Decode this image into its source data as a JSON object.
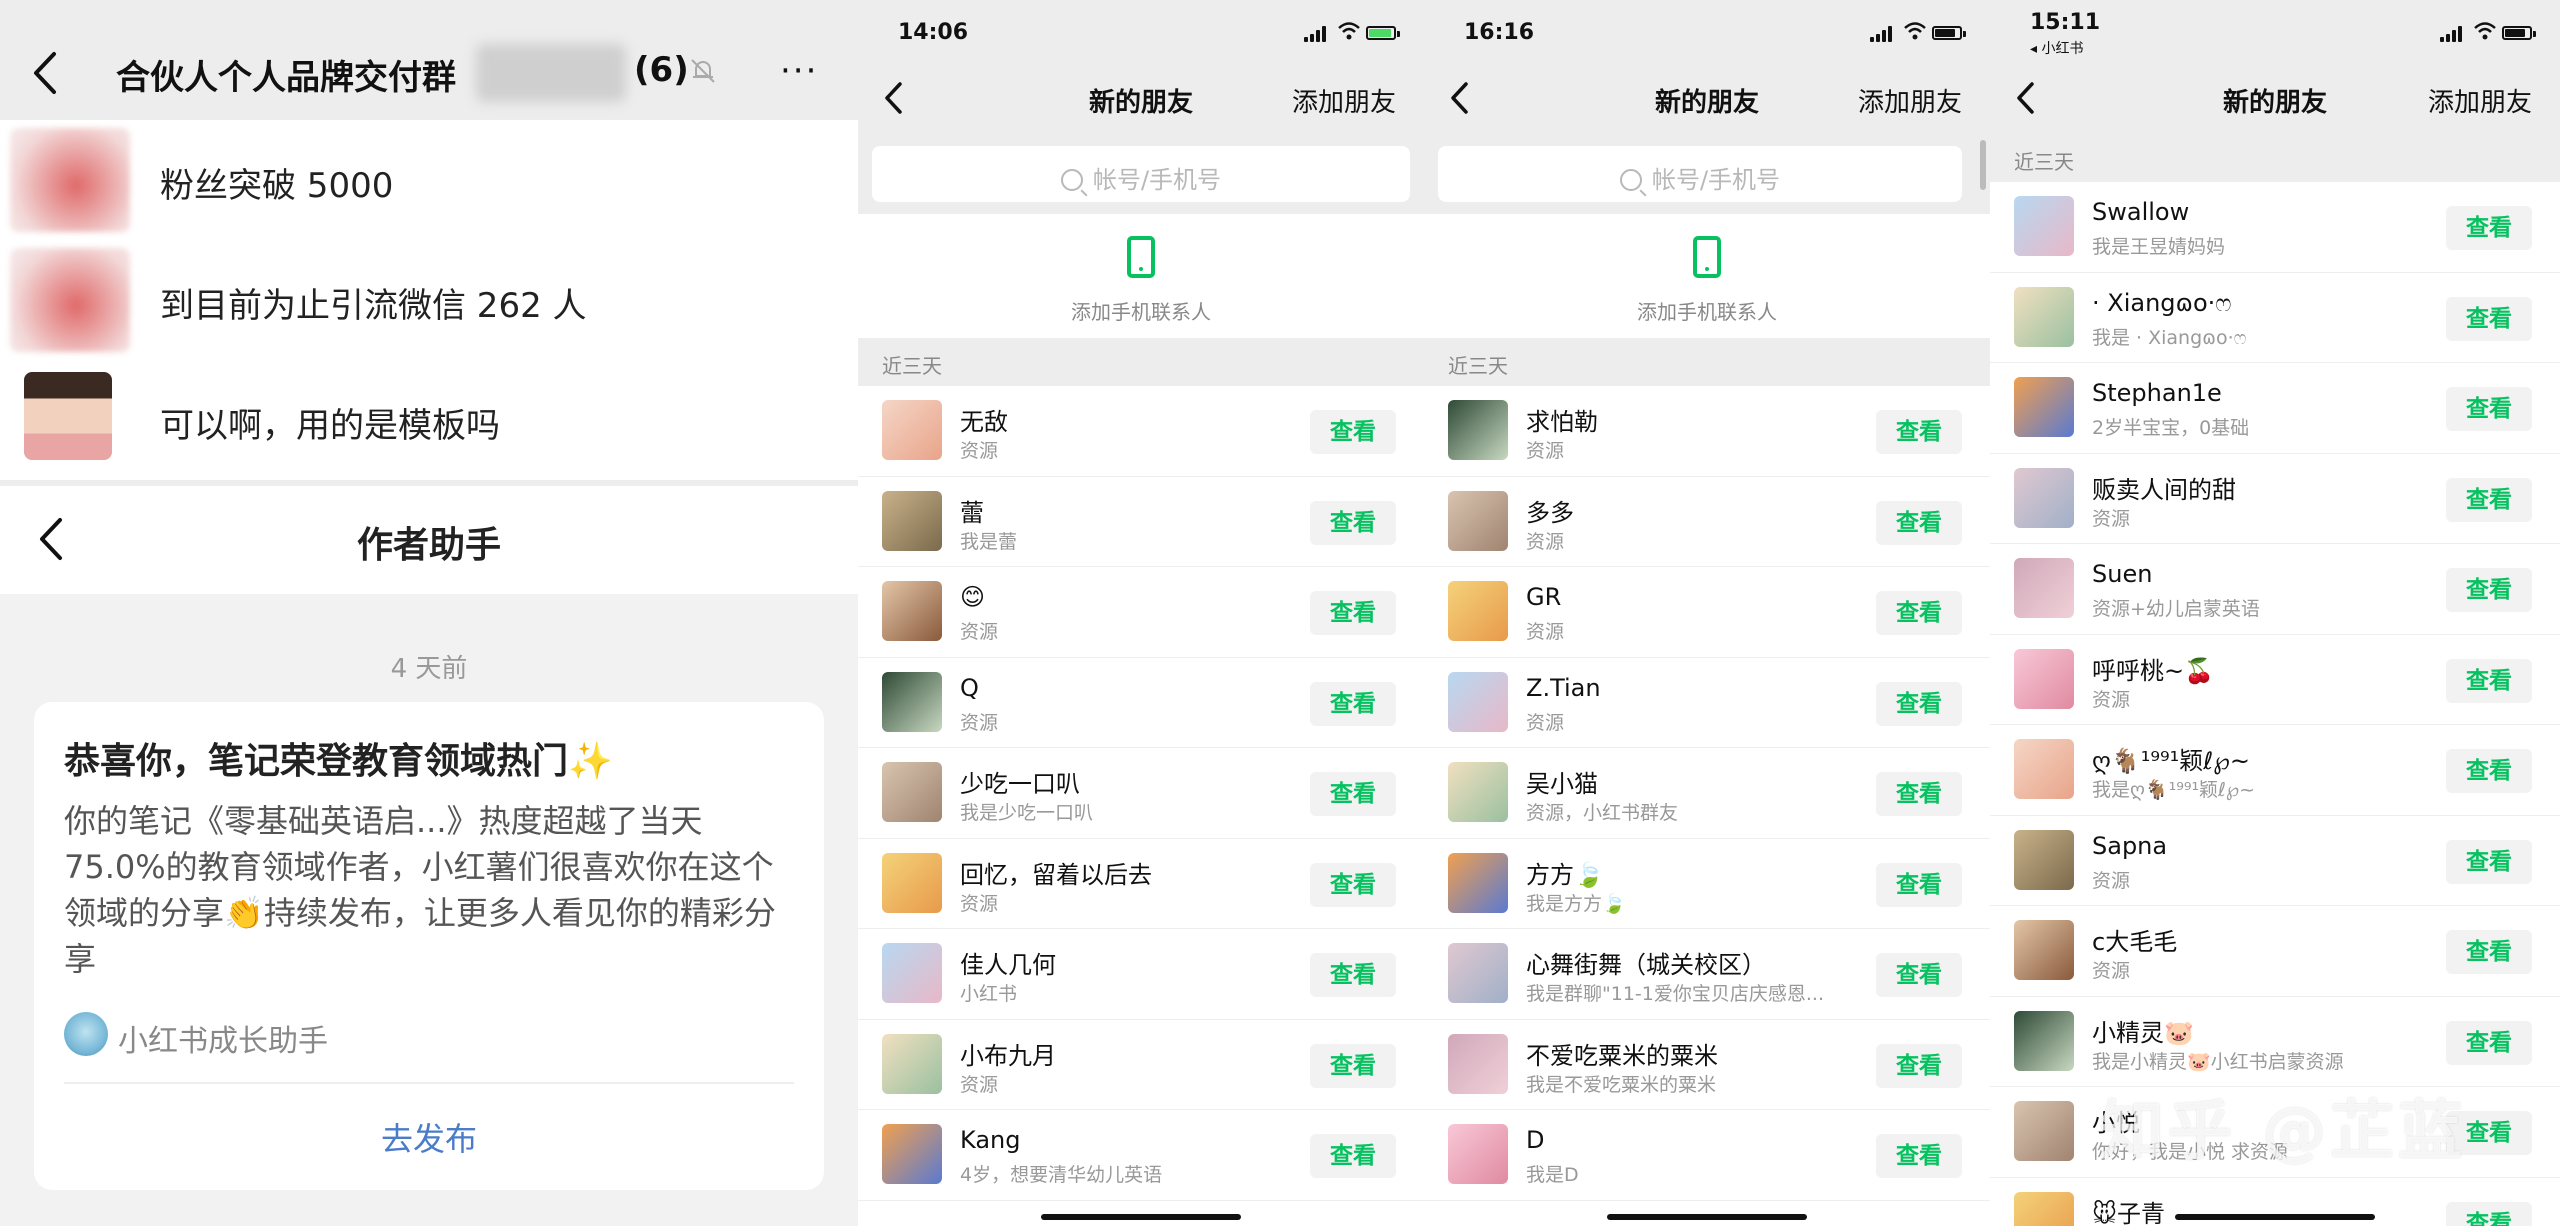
{
  "panel1": {
    "group_title": "合伙人个人品牌交付群",
    "group_count": "(6)",
    "messages": [
      {
        "text": "粉丝突破 5000"
      },
      {
        "text": "到目前为止引流微信 262 人"
      },
      {
        "text": "可以啊，用的是模板吗"
      }
    ],
    "sub_title": "作者助手",
    "time": "4 天前",
    "card_title": "恭喜你，笔记荣登教育领域热门✨",
    "card_text": "你的笔记《零基础英语启...》热度超越了当天75.0%的教育领域作者，小红薯们很喜欢你在这个领域的分享👏持续发布，让更多人看见你的精彩分享",
    "sender": "小红书成长助手",
    "cta": "去发布"
  },
  "panel2": {
    "time": "14:06",
    "title": "新的朋友",
    "add": "添加朋友",
    "search_placeholder": "帐号/手机号",
    "add_phone_label": "添加手机联系人",
    "section": "近三天",
    "rows": [
      {
        "name": "无敌",
        "sub": "资源",
        "btn": "查看"
      },
      {
        "name": "蕾",
        "sub": "我是蕾",
        "btn": "查看"
      },
      {
        "name": "😊",
        "sub": "资源",
        "btn": "查看"
      },
      {
        "name": "Q",
        "sub": "资源",
        "btn": "查看"
      },
      {
        "name": "少吃一口叭",
        "sub": "我是少吃一口叭",
        "btn": "查看"
      },
      {
        "name": "回忆，留着以后去",
        "sub": "资源",
        "btn": "查看"
      },
      {
        "name": "佳人几何",
        "sub": "小红书",
        "btn": "查看"
      },
      {
        "name": "小布九月",
        "sub": "资源",
        "btn": "查看"
      },
      {
        "name": "Kang",
        "sub": "4岁，想要清华幼儿英语",
        "btn": "查看"
      }
    ]
  },
  "panel3": {
    "time": "16:16",
    "title": "新的朋友",
    "add": "添加朋友",
    "search_placeholder": "帐号/手机号",
    "add_phone_label": "添加手机联系人",
    "section": "近三天",
    "rows": [
      {
        "name": "求怕勒",
        "sub": "资源",
        "btn": "查看"
      },
      {
        "name": "多多",
        "sub": "资源",
        "btn": "查看"
      },
      {
        "name": "GR",
        "sub": "资源",
        "btn": "查看"
      },
      {
        "name": "Z.Tian",
        "sub": "资源",
        "btn": "查看"
      },
      {
        "name": "吴小猫",
        "sub": "资源，小红书群友",
        "btn": "查看"
      },
      {
        "name": "方方🍃",
        "sub": "我是方方🍃",
        "btn": "查看"
      },
      {
        "name": "心舞街舞（城关校区）",
        "sub": "我是群聊\"11-1爱你宝贝店庆感恩...",
        "btn": "查看"
      },
      {
        "name": "不爱吃粟米的粟米",
        "sub": "我是不爱吃粟米的粟米",
        "btn": "查看"
      },
      {
        "name": "D",
        "sub": "我是D",
        "btn": "查看"
      }
    ]
  },
  "panel4": {
    "time": "15:11",
    "back_app": "◂ 小红书",
    "title": "新的朋友",
    "add": "添加朋友",
    "section": "近三天",
    "rows": [
      {
        "name": "Swallow",
        "sub": "我是王昱婧妈妈",
        "btn": "查看"
      },
      {
        "name": "· Xiangɷo·ෆ",
        "sub": "我是 · Xiangɷo·ෆ",
        "btn": "查看"
      },
      {
        "name": "Stephan1e",
        "sub": "2岁半宝宝，0基础",
        "btn": "查看"
      },
      {
        "name": "贩卖人间的甜",
        "sub": "资源",
        "btn": "查看"
      },
      {
        "name": "Suen",
        "sub": "资源+幼儿启蒙英语",
        "btn": "查看"
      },
      {
        "name": "呼呼桃~🍒",
        "sub": "资源",
        "btn": "查看"
      },
      {
        "name": "ღ🐐¹⁹⁹¹颖ℓ℘~",
        "sub": "我是ღ🐐¹⁹⁹¹颖ℓ℘~",
        "btn": "查看"
      },
      {
        "name": "Sapna",
        "sub": "资源",
        "btn": "查看"
      },
      {
        "name": "c大毛毛",
        "sub": "资源",
        "btn": "查看"
      },
      {
        "name": "小精灵🐷",
        "sub": "我是小精灵🐷小红书启蒙资源",
        "btn": "查看"
      },
      {
        "name": "小悦",
        "sub": "你好，我是小悦 求资源",
        "btn": "查看"
      },
      {
        "name": "🐭子青",
        "sub": "",
        "btn": "查看"
      }
    ]
  },
  "watermark": "知乎 @芷蓝",
  "colors": {
    "accent": "#07c160",
    "link": "#4a7cc8",
    "bg": "#ededed"
  }
}
